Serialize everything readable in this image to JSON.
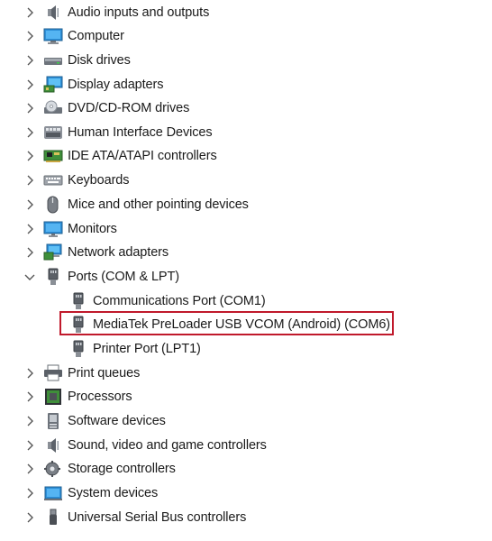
{
  "tree": {
    "items": [
      {
        "label": "Audio inputs and outputs",
        "icon": "speaker-icon",
        "expanded": false
      },
      {
        "label": "Computer",
        "icon": "computer-icon",
        "expanded": false
      },
      {
        "label": "Disk drives",
        "icon": "disk-drive-icon",
        "expanded": false
      },
      {
        "label": "Display adapters",
        "icon": "display-adapter-icon",
        "expanded": false
      },
      {
        "label": "DVD/CD-ROM drives",
        "icon": "dvd-drive-icon",
        "expanded": false
      },
      {
        "label": "Human Interface Devices",
        "icon": "hid-icon",
        "expanded": false
      },
      {
        "label": "IDE ATA/ATAPI controllers",
        "icon": "ide-controller-icon",
        "expanded": false
      },
      {
        "label": "Keyboards",
        "icon": "keyboard-icon",
        "expanded": false
      },
      {
        "label": "Mice and other pointing devices",
        "icon": "mouse-icon",
        "expanded": false
      },
      {
        "label": "Monitors",
        "icon": "monitor-icon",
        "expanded": false
      },
      {
        "label": "Network adapters",
        "icon": "network-adapter-icon",
        "expanded": false
      },
      {
        "label": "Ports (COM & LPT)",
        "icon": "port-icon",
        "expanded": true,
        "children": [
          {
            "label": "Communications Port (COM1)",
            "icon": "port-icon"
          },
          {
            "label": "MediaTek PreLoader USB VCOM (Android) (COM6)",
            "icon": "port-icon",
            "highlighted": true
          },
          {
            "label": "Printer Port (LPT1)",
            "icon": "port-icon"
          }
        ]
      },
      {
        "label": "Print queues",
        "icon": "printer-icon",
        "expanded": false
      },
      {
        "label": "Processors",
        "icon": "processor-icon",
        "expanded": false
      },
      {
        "label": "Software devices",
        "icon": "software-device-icon",
        "expanded": false
      },
      {
        "label": "Sound, video and game controllers",
        "icon": "speaker-icon",
        "expanded": false
      },
      {
        "label": "Storage controllers",
        "icon": "storage-controller-icon",
        "expanded": false
      },
      {
        "label": "System devices",
        "icon": "system-device-icon",
        "expanded": false
      },
      {
        "label": "Universal Serial Bus controllers",
        "icon": "usb-icon",
        "expanded": false
      }
    ]
  },
  "colors": {
    "highlight_border": "#c0192b",
    "chevron": "#555555",
    "text": "#1a1a1a"
  }
}
